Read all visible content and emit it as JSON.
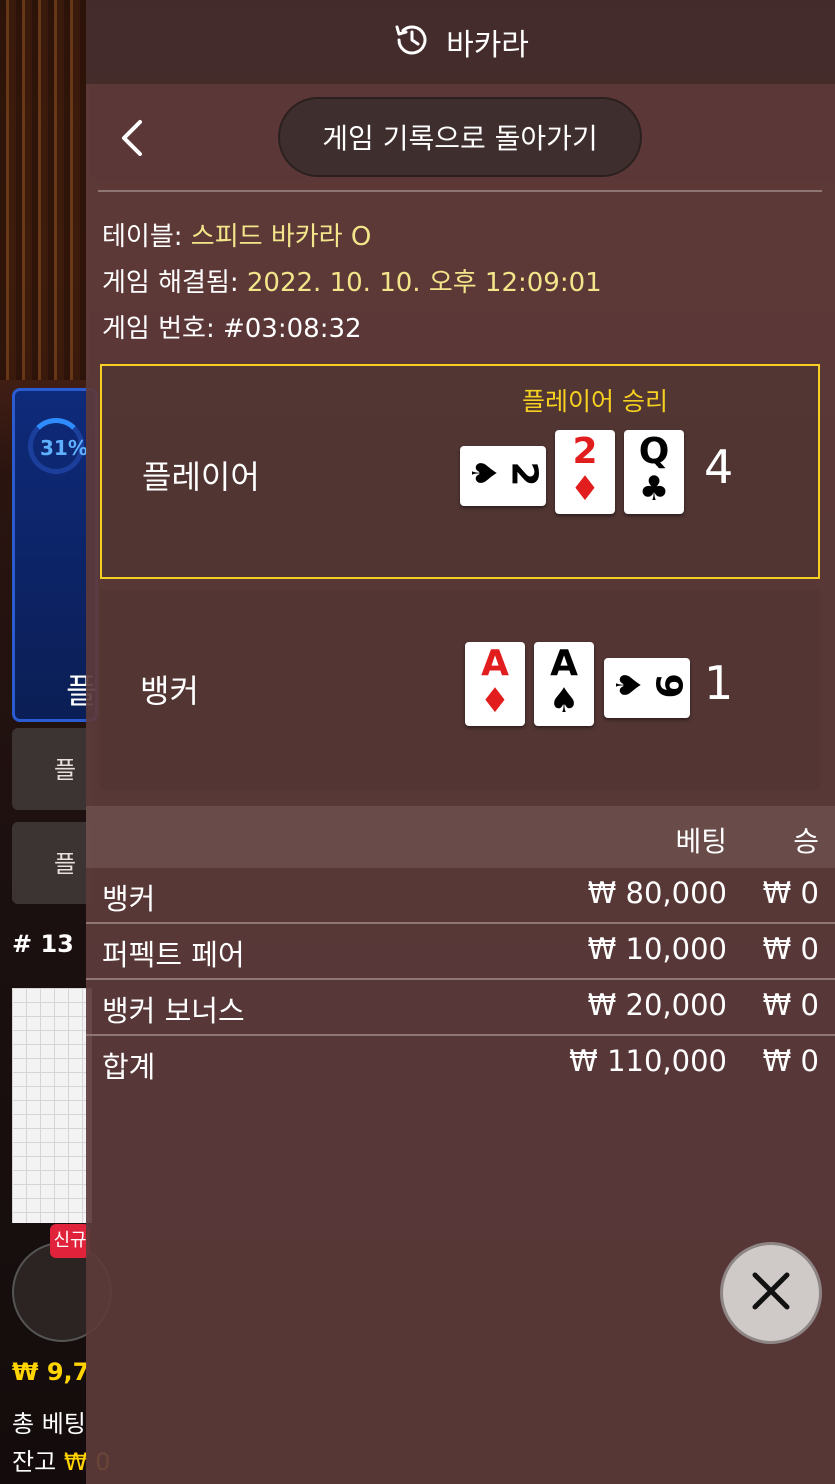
{
  "background": {
    "percent": "31%",
    "player_label": "플",
    "btn1": "플",
    "btn2": "플",
    "round_no": "# 13",
    "new_badge": "신규",
    "balance_line1": "₩ 9,7",
    "total_bet_label": "총 베팅",
    "balance_label": "잔고",
    "balance_value": "₩ 0"
  },
  "header": {
    "title": "바카라",
    "icon": "history-icon"
  },
  "nav": {
    "back_icon": "chevron-left-icon",
    "return_label": "게임 기록으로 돌아가기"
  },
  "info": {
    "table_label": "테이블:",
    "table_value": "스피드 바카라 O",
    "resolved_label": "게임 해결됨:",
    "resolved_value": "2022. 10. 10. 오후 12:09:01",
    "game_no_label": "게임 번호:",
    "game_no_value": "#03:08:32"
  },
  "player": {
    "label": "플레이어",
    "result": "플레이어 승리",
    "score": "4",
    "cards": [
      {
        "rank": "2",
        "suit": "♠",
        "color": "#000000",
        "orientation": "side"
      },
      {
        "rank": "2",
        "suit": "♦",
        "color": "#e11d1d",
        "orientation": "up"
      },
      {
        "rank": "Q",
        "suit": "♣",
        "color": "#000000",
        "orientation": "up"
      }
    ]
  },
  "banker": {
    "label": "뱅커",
    "score": "1",
    "cards": [
      {
        "rank": "A",
        "suit": "♦",
        "color": "#e11d1d",
        "orientation": "up"
      },
      {
        "rank": "A",
        "suit": "♠",
        "color": "#000000",
        "orientation": "up"
      },
      {
        "rank": "9",
        "suit": "♠",
        "color": "#000000",
        "orientation": "side"
      }
    ]
  },
  "bets": {
    "header_bet": "베팅",
    "header_win": "승",
    "rows": [
      {
        "name": "뱅커",
        "bet": "₩ 80,000",
        "win": "₩ 0"
      },
      {
        "name": "퍼펙트 페어",
        "bet": "₩ 10,000",
        "win": "₩ 0"
      },
      {
        "name": "뱅커 보너스",
        "bet": "₩ 20,000",
        "win": "₩ 0"
      },
      {
        "name": "합계",
        "bet": "₩ 110,000",
        "win": "₩ 0"
      }
    ]
  },
  "close": {
    "icon": "close-icon"
  },
  "colors": {
    "win_highlight": "#f5d020",
    "info_value": "#f3e58a",
    "red_suit": "#e11d1d"
  }
}
